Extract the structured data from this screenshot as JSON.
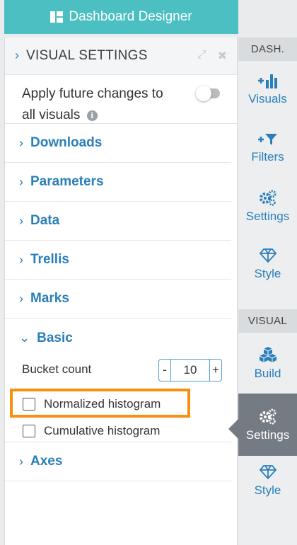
{
  "header": {
    "title": "Dashboard Designer",
    "icon": "dashboard-icon"
  },
  "visual_settings": {
    "title": "VISUAL SETTINGS",
    "apply_future_line1": "Apply future changes to",
    "apply_future_line2": "all visuals",
    "apply_future_toggle": "off",
    "sections": [
      {
        "label": "Downloads"
      },
      {
        "label": "Parameters"
      },
      {
        "label": "Data"
      },
      {
        "label": "Trellis"
      },
      {
        "label": "Marks"
      },
      {
        "label": "Basic"
      },
      {
        "label": "Axes"
      }
    ],
    "basic": {
      "bucket_count_label": "Bucket count",
      "bucket_count_value": "10",
      "minus": "-",
      "plus": "+",
      "normalized_label": "Normalized histogram",
      "normalized_checked": false,
      "cumulative_label": "Cumulative histogram",
      "cumulative_checked": false
    },
    "highlight_color": "#f7900f"
  },
  "rail": {
    "dash_label": "DASH.",
    "visual_label": "VISUAL",
    "dash_items": [
      {
        "label": "Visuals",
        "icon": "visuals-icon"
      },
      {
        "label": "Filters",
        "icon": "filters-icon"
      },
      {
        "label": "Settings",
        "icon": "gears-icon"
      },
      {
        "label": "Style",
        "icon": "diamond-icon"
      }
    ],
    "visual_items": [
      {
        "label": "Build",
        "icon": "cubes-icon"
      },
      {
        "label": "Settings",
        "icon": "gears-icon",
        "active": true
      },
      {
        "label": "Style",
        "icon": "diamond-icon"
      }
    ]
  },
  "colors": {
    "accent": "#2a7fb8",
    "header_bg": "#4bbfc1",
    "active_bg": "#757b82"
  }
}
